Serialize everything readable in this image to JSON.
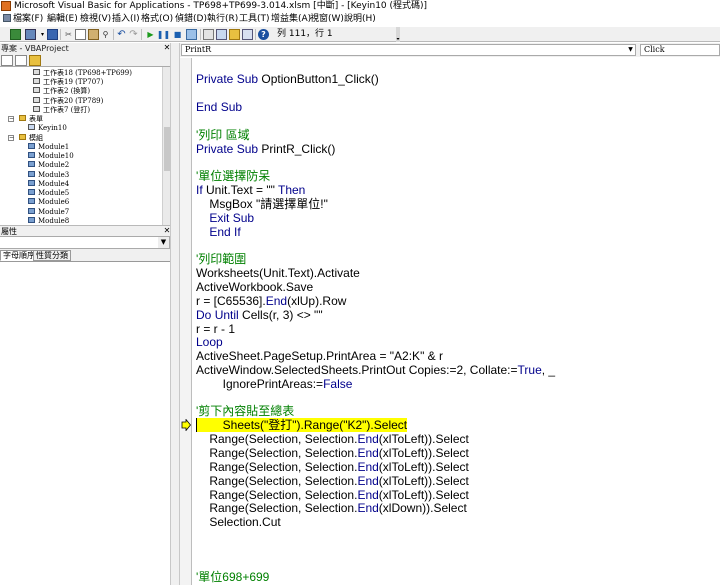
{
  "window": {
    "title": "Microsoft Visual Basic for Applications - TP698+TP699-3.014.xlsm [中斷] - [Keyin10 (程式碼)]"
  },
  "menu": [
    {
      "label": "檔案(F)"
    },
    {
      "label": "編輯(E)"
    },
    {
      "label": "檢視(V)"
    },
    {
      "label": "插入(I)"
    },
    {
      "label": "格式(O)"
    },
    {
      "label": "偵錯(D)"
    },
    {
      "label": "執行(R)"
    },
    {
      "label": "工具(T)"
    },
    {
      "label": "增益集(A)"
    },
    {
      "label": "視窗(W)"
    },
    {
      "label": "說明(H)"
    }
  ],
  "toolbar": {
    "position": "列 111，行 1"
  },
  "project": {
    "title": "專案 - VBAProject",
    "tree": [
      {
        "label": "工作表18 (TP698+TP699)",
        "icon": "sheet-icon"
      },
      {
        "label": "工作表19 (TP707)",
        "icon": "sheet-icon"
      },
      {
        "label": "工作表2 (換算)",
        "icon": "sheet-icon"
      },
      {
        "label": "工作表20 (TP789)",
        "icon": "sheet-icon"
      },
      {
        "label": "工作表7 (登打)",
        "icon": "sheet-icon"
      },
      {
        "label": "表單",
        "icon": "folder-icon"
      },
      {
        "label": "Keyin10",
        "icon": "form-icon"
      },
      {
        "label": "模組",
        "icon": "folder-icon"
      },
      {
        "label": "Module1",
        "icon": "module-icon"
      },
      {
        "label": "Module10",
        "icon": "module-icon"
      },
      {
        "label": "Module2",
        "icon": "module-icon"
      },
      {
        "label": "Module3",
        "icon": "module-icon"
      },
      {
        "label": "Module4",
        "icon": "module-icon"
      },
      {
        "label": "Module5",
        "icon": "module-icon"
      },
      {
        "label": "Module6",
        "icon": "module-icon"
      },
      {
        "label": "Module7",
        "icon": "module-icon"
      },
      {
        "label": "Module8",
        "icon": "module-icon"
      }
    ]
  },
  "properties": {
    "title": "屬性",
    "tabs": [
      "字母順序",
      "性質分類"
    ]
  },
  "editor": {
    "object": "PrintR",
    "procedure": "Click",
    "lines": [
      {
        "text": "Private Sub OptionButton1_Click()"
      },
      {
        "text": "End Sub"
      },
      {
        "text": "'列印 區域"
      },
      {
        "text": "Private Sub PrintR_Click()"
      },
      {
        "text": "'單位選擇防呆"
      },
      {
        "text": "If Unit.Text = \"\" Then"
      },
      {
        "text": "    MsgBox \"請選擇單位!\""
      },
      {
        "text": "    Exit Sub"
      },
      {
        "text": "    End If"
      },
      {
        "text": "'列印範圍"
      },
      {
        "text": "Worksheets(Unit.Text).Activate"
      },
      {
        "text": "ActiveWorkbook.Save"
      },
      {
        "text": "r = [C65536].End(xlUp).Row"
      },
      {
        "text": "Do Until Cells(r, 3) <> \"\""
      },
      {
        "text": "r = r - 1"
      },
      {
        "text": "Loop"
      },
      {
        "text": "ActiveSheet.PageSetup.PrintArea = \"A2:K\" & r"
      },
      {
        "text": "ActiveWindow.SelectedSheets.PrintOut Copies:=2, Collate:=True, _"
      },
      {
        "text": "        IgnorePrintAreas:=False"
      },
      {
        "text": "'剪下內容貼至總表"
      },
      {
        "text": "        Sheets(\"登打\").Range(\"K2\").Select"
      },
      {
        "text": "    Range(Selection, Selection.End(xlToLeft)).Select"
      },
      {
        "text": "    Range(Selection, Selection.End(xlToLeft)).Select"
      },
      {
        "text": "    Range(Selection, Selection.End(xlToLeft)).Select"
      },
      {
        "text": "    Range(Selection, Selection.End(xlToLeft)).Select"
      },
      {
        "text": "    Range(Selection, Selection.End(xlToLeft)).Select"
      },
      {
        "text": "    Range(Selection, Selection.End(xlDown)).Select"
      },
      {
        "text": "    Selection.Cut"
      },
      {
        "text": "'單位698+699"
      }
    ]
  }
}
